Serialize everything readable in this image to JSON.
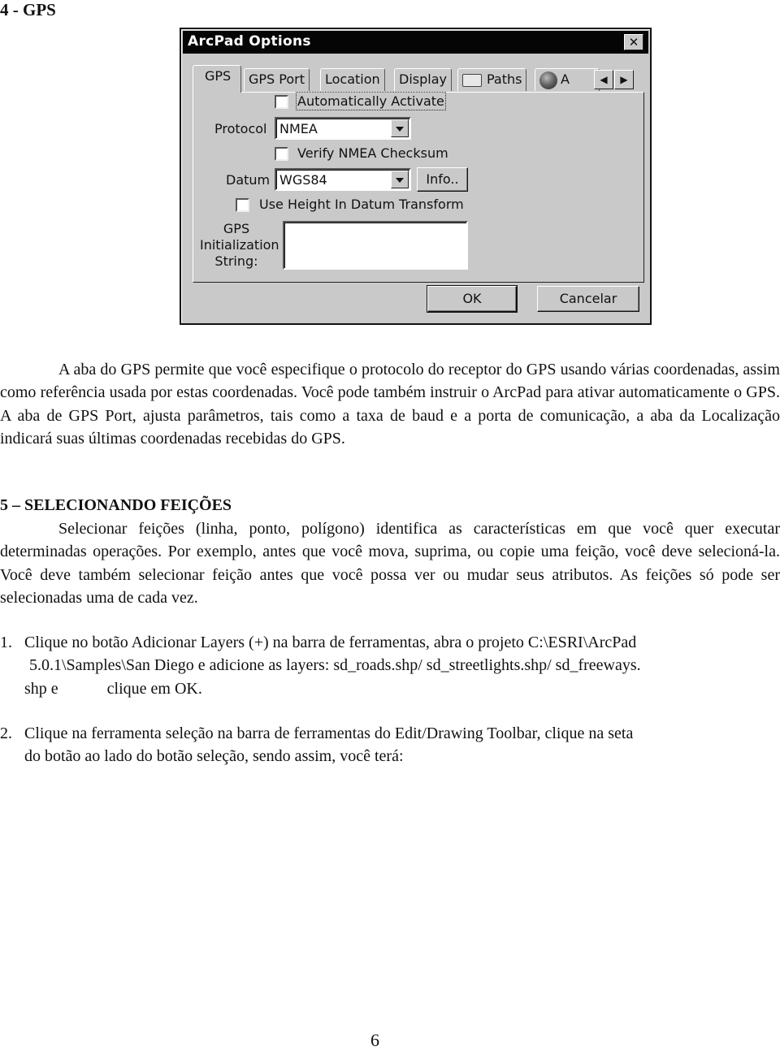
{
  "section_4_heading": "4 - GPS",
  "dialog": {
    "title": "ArcPad Options",
    "close_icon": "close-icon",
    "tabs": [
      {
        "label": "GPS",
        "active": true
      },
      {
        "label": "GPS Port",
        "active": false
      },
      {
        "label": "Location",
        "active": false
      },
      {
        "label": "Display",
        "active": false
      },
      {
        "label": "Paths",
        "active": false,
        "icon": "folder-icon"
      },
      {
        "label": "A",
        "active": false,
        "icon": "globe-icon"
      }
    ],
    "tab_scroll": {
      "left": "◀",
      "right": "▶"
    },
    "auto_activate": {
      "label": "Automatically Activate",
      "checked": false
    },
    "protocol": {
      "label": "Protocol",
      "value": "NMEA"
    },
    "verify_checksum": {
      "label": "Verify NMEA Checksum",
      "checked": false
    },
    "datum": {
      "label": "Datum",
      "value": "WGS84",
      "info_button": "Info.."
    },
    "use_height": {
      "label": "Use Height In Datum Transform",
      "checked": false
    },
    "init_string": {
      "label_lines": [
        "GPS",
        "Initialization",
        "String:"
      ],
      "value": ""
    },
    "ok_button": "OK",
    "cancel_button": "Cancelar"
  },
  "paragraph_gps": "A aba do GPS permite que você especifique o protocolo do receptor do GPS usando várias coordenadas, assim como referência usada por estas coordenadas. Você pode também instruir o ArcPad para ativar automaticamente o GPS. A aba de GPS Port, ajusta parâmetros, tais como a taxa de baud e a porta de comunicação, a aba da Localização indicará suas últimas coordenadas recebidas do GPS.",
  "section_5_heading": "5 – SELECIONANDO FEIÇÕES",
  "paragraph_select": "Selecionar feições (linha, ponto, polígono) identifica as características em que você quer executar determinadas operações. Por exemplo, antes que você mova, suprima, ou copie uma feição, você deve selecioná-la. Você deve também selecionar feição antes que você possa ver ou mudar seus atributos. As feições só pode ser selecionadas uma de cada vez.",
  "steps": [
    {
      "number": "1.",
      "lines": [
        "Clique no botão Adicionar Layers (+) na barra de ferramentas, abra o projeto C:\\ESRI\\ArcPad",
        "5.0.1\\Samples\\San Diego e adicione as layers: sd_roads.shp/ sd_streetlights.shp/ sd_freeways.",
        "shp e",
        "clique em OK."
      ]
    },
    {
      "number": "2.",
      "lines": [
        "Clique na ferramenta seleção na barra de ferramentas do Edit/Drawing Toolbar, clique na seta",
        "do botão ao lado do botão seleção, sendo assim, você terá:"
      ]
    }
  ],
  "page_number": "6"
}
